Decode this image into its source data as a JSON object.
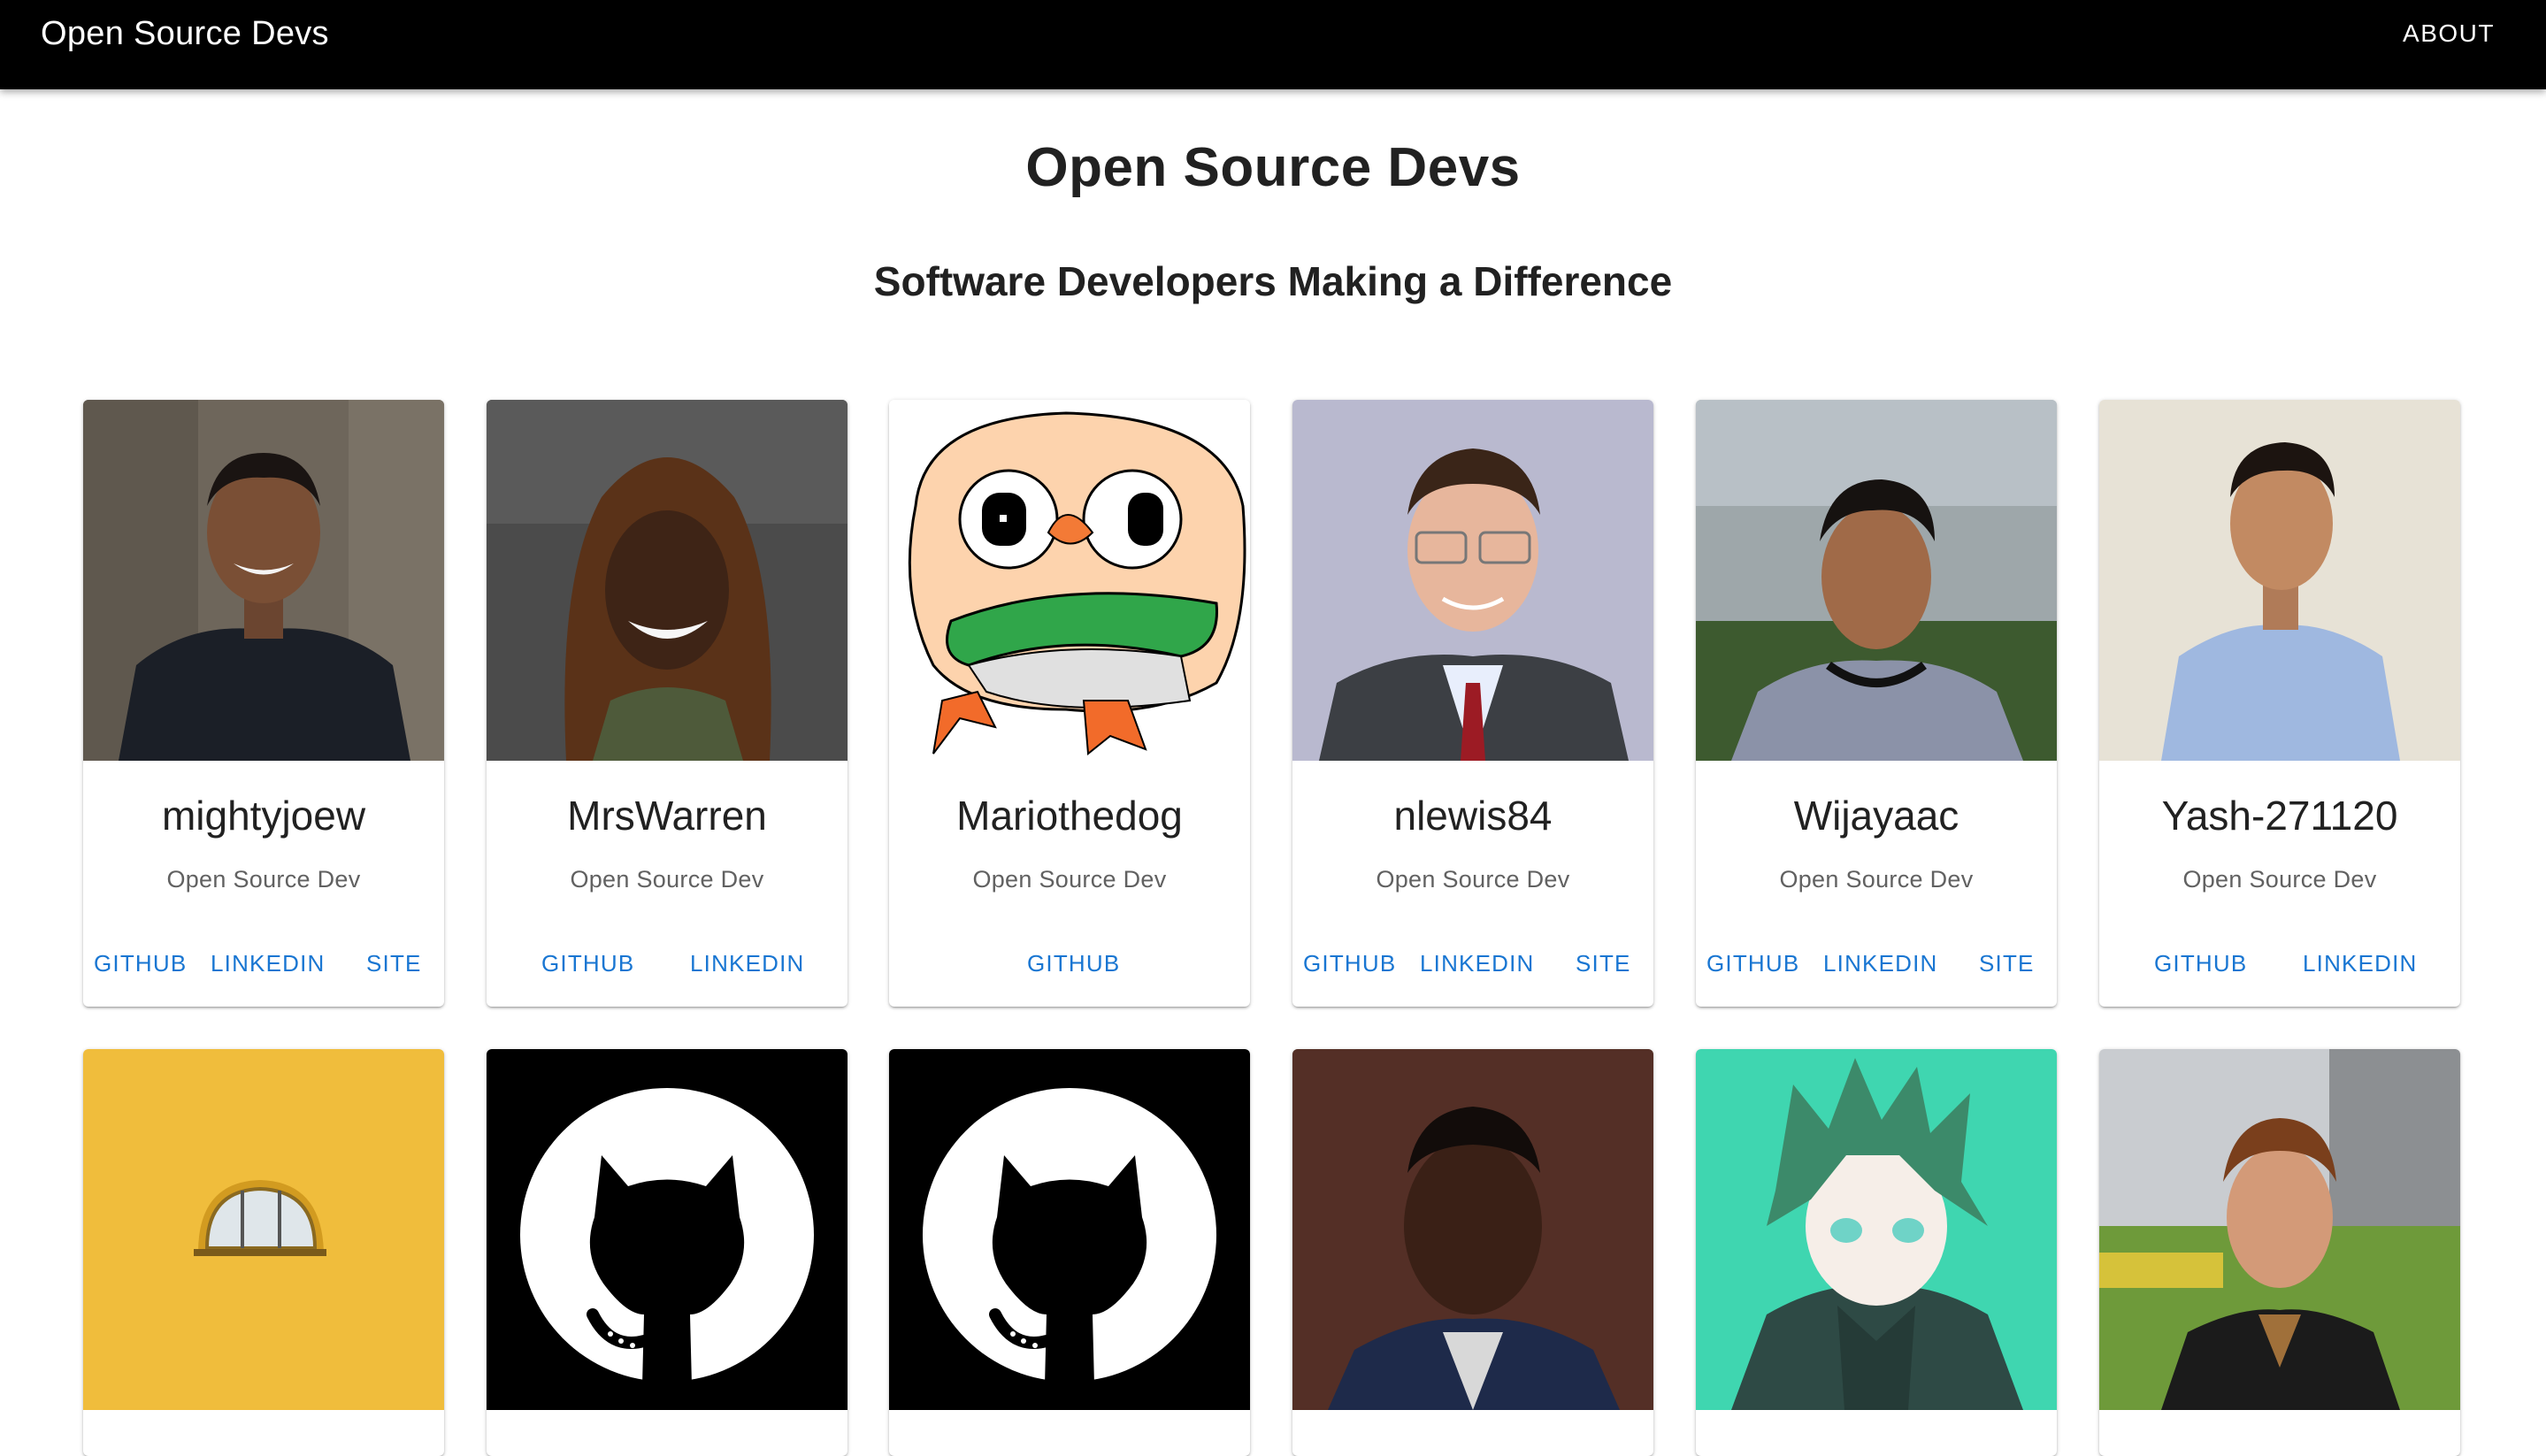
{
  "appbar": {
    "brand": "Open Source Devs",
    "about_label": "ABOUT"
  },
  "hero": {
    "title": "Open Source Devs",
    "subtitle": "Software Developers Making a Difference"
  },
  "colors": {
    "appbar_bg": "#000000",
    "link": "#1976d2"
  },
  "cards": [
    {
      "name": "mightyjoew",
      "role": "Open Source Dev",
      "links": [
        "GITHUB",
        "LINKEDIN",
        "SITE"
      ],
      "avatar": "photo-man-dark-shirt"
    },
    {
      "name": "MrsWarren",
      "role": "Open Source Dev",
      "links": [
        "GITHUB",
        "LINKEDIN"
      ],
      "avatar": "photo-woman-smiling"
    },
    {
      "name": "Mariothedog",
      "role": "Open Source Dev",
      "links": [
        "GITHUB"
      ],
      "avatar": "owl-drawing"
    },
    {
      "name": "nlewis84",
      "role": "Open Source Dev",
      "links": [
        "GITHUB",
        "LINKEDIN",
        "SITE"
      ],
      "avatar": "photo-man-suit-glasses"
    },
    {
      "name": "Wijayaac",
      "role": "Open Source Dev",
      "links": [
        "GITHUB",
        "LINKEDIN",
        "SITE"
      ],
      "avatar": "photo-man-beach"
    },
    {
      "name": "Yash-271120",
      "role": "Open Source Dev",
      "links": [
        "GITHUB",
        "LINKEDIN"
      ],
      "avatar": "photo-man-blue-shirt"
    }
  ],
  "cards_row2": [
    {
      "avatar": "yellow-wall-window"
    },
    {
      "avatar": "github-octocat-logo"
    },
    {
      "avatar": "github-octocat-logo"
    },
    {
      "avatar": "photo-man-portrait"
    },
    {
      "avatar": "anime-character"
    },
    {
      "avatar": "photo-man-outdoor"
    }
  ]
}
